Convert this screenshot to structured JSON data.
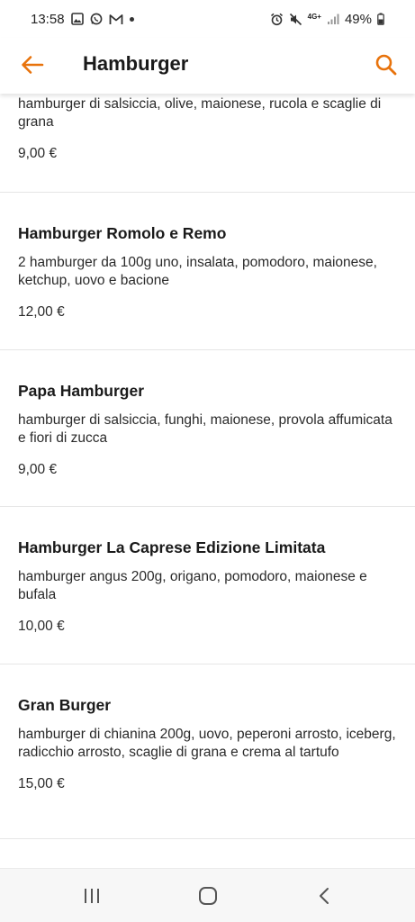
{
  "status_bar": {
    "time": "13:58",
    "network": "4G+",
    "battery": "49%"
  },
  "header": {
    "title": "Hamburger"
  },
  "menu_items": [
    {
      "name": "",
      "description": "hamburger di salsiccia, olive, maionese, rucola e scaglie di grana",
      "price": "9,00 €"
    },
    {
      "name": "Hamburger Romolo e Remo",
      "description": "2 hamburger da 100g uno, insalata, pomodoro, maionese, ketchup, uovo e bacione",
      "price": "12,00 €"
    },
    {
      "name": "Papa Hamburger",
      "description": "hamburger di salsiccia, funghi, maionese, provola affumicata e fiori di zucca",
      "price": "9,00 €"
    },
    {
      "name": "Hamburger La Caprese Edizione Limitata",
      "description": "hamburger angus 200g, origano, pomodoro, maionese e bufala",
      "price": "10,00 €"
    },
    {
      "name": "Gran Burger",
      "description": "hamburger di chianina 200g, uovo, peperoni arrosto, iceberg, radicchio arrosto, scaglie di grana e crema al tartufo",
      "price": "15,00 €"
    }
  ],
  "colors": {
    "accent": "#e8730c",
    "divider": "#e6e6e6"
  },
  "icons": {
    "back": "arrow-left-icon",
    "search": "search-icon",
    "nav_recents": "recents-icon",
    "nav_home": "home-icon",
    "nav_back": "nav-back-icon"
  }
}
